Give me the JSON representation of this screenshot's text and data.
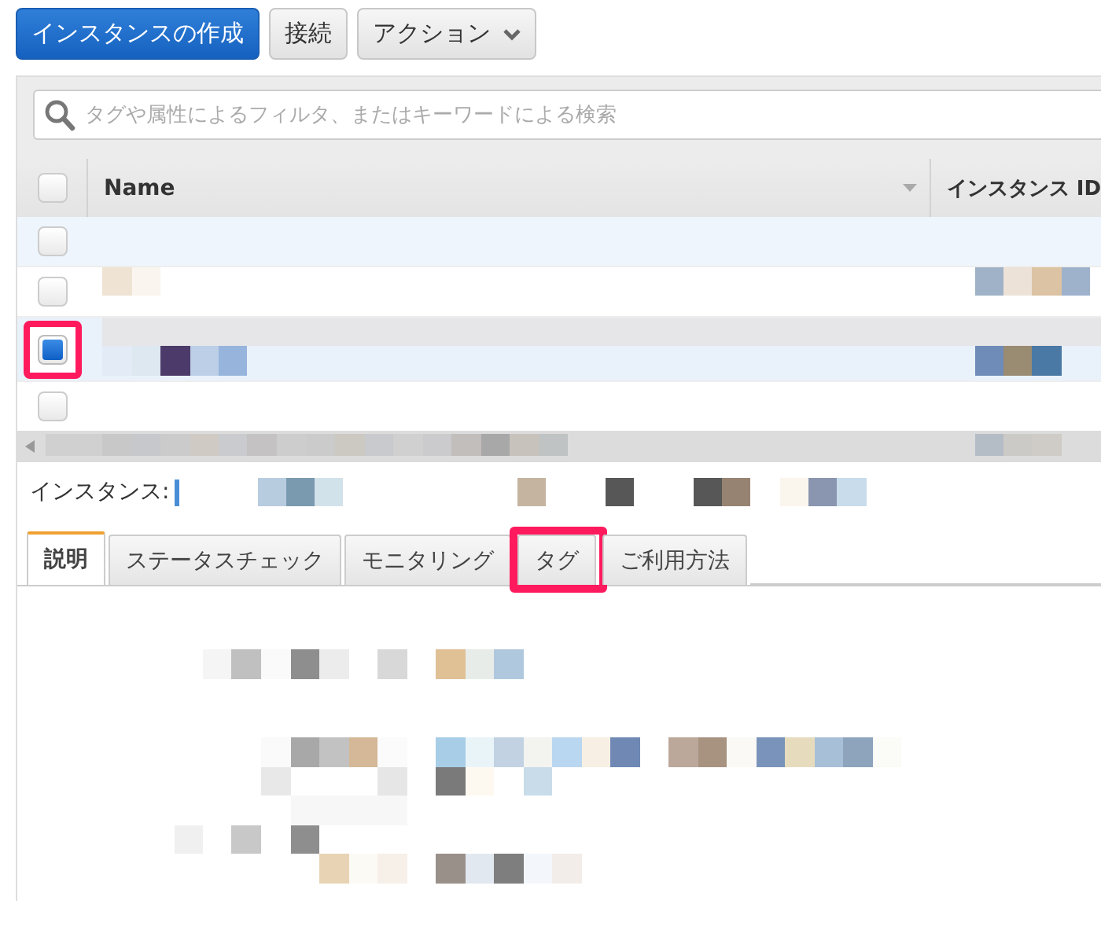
{
  "toolbar": {
    "buttons": [
      {
        "label": "インスタンスの作成",
        "kind": "primary"
      },
      {
        "label": "接続",
        "kind": "default"
      },
      {
        "label": "アクション",
        "kind": "dropdown"
      }
    ]
  },
  "search": {
    "placeholder": "タグや属性によるフィルタ、またはキーワードによる検索"
  },
  "table": {
    "select_all": {
      "checked": false
    },
    "columns": [
      "Name",
      "インスタンス ID"
    ],
    "rows": [
      {
        "selected": false,
        "hovered": true,
        "highlighted": false
      },
      {
        "selected": false,
        "hovered": false,
        "highlighted": false
      },
      {
        "selected": true,
        "hovered": false,
        "highlighted": true
      },
      {
        "selected": false,
        "hovered": false,
        "highlighted": false
      }
    ]
  },
  "selection_label": "インスタンス:",
  "tabs": [
    {
      "label": "説明",
      "selected": true,
      "highlighted": false
    },
    {
      "label": "ステータスチェック",
      "selected": false,
      "highlighted": false
    },
    {
      "label": "モニタリング",
      "selected": false,
      "highlighted": false
    },
    {
      "label": "タグ",
      "selected": false,
      "highlighted": true
    },
    {
      "label": "ご利用方法",
      "selected": false,
      "highlighted": false
    }
  ]
}
